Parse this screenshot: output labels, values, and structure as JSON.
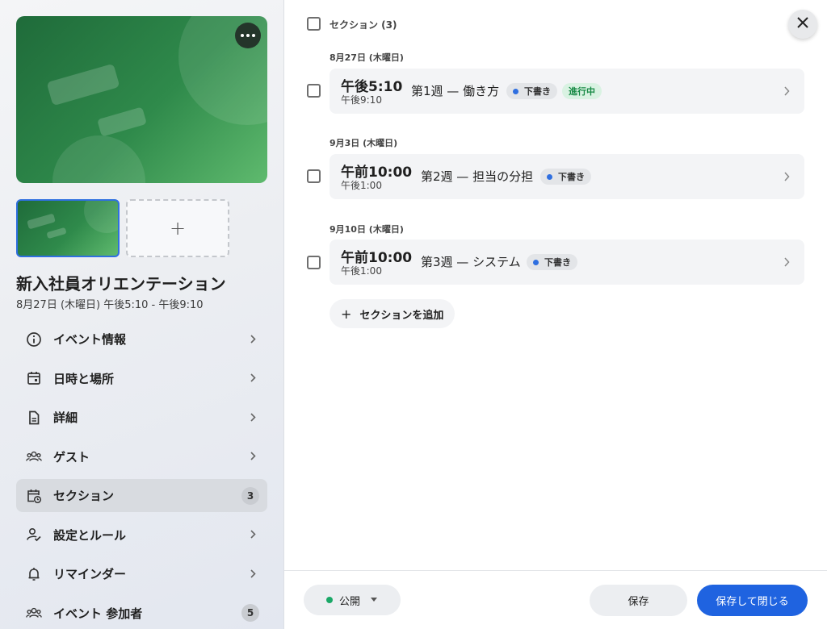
{
  "colors": {
    "accent": "#1f63e0",
    "active_nav": "#d8dbe0",
    "draft_dot": "#2f6fe0",
    "in_progress": "#188a45",
    "public_dot": "#1aa867"
  },
  "hero": {
    "more_icon": "more-horizontal-icon"
  },
  "media": {
    "add_symbol": "+"
  },
  "event": {
    "title": "新入社員オリエンテーション",
    "date": "8月27日 (木曜日) 午後5:10 - 午後9:10"
  },
  "sidebar": {
    "items": [
      {
        "label": "イベント情報",
        "icon": "info-icon"
      },
      {
        "label": "日時と場所",
        "icon": "calendar-icon"
      },
      {
        "label": "詳細",
        "icon": "document-icon"
      },
      {
        "label": "ゲスト",
        "icon": "group-icon"
      },
      {
        "label": "セクション",
        "icon": "calendar-clock-icon",
        "badge": "3",
        "active": true
      },
      {
        "label": "設定とルール",
        "icon": "person-check-icon"
      },
      {
        "label": "リマインダー",
        "icon": "bell-icon"
      },
      {
        "label": "イベント 参加者",
        "icon": "group-icon",
        "badge": "5"
      }
    ]
  },
  "main": {
    "header_label": "セクション (3)",
    "groups": [
      {
        "date": "8月27日 (木曜日)",
        "start": "午後5:10",
        "end": "午後9:10",
        "title": "第1週 — 働き方",
        "status": "下書き",
        "progress": "進行中"
      },
      {
        "date": "9月3日 (木曜日)",
        "start": "午前10:00",
        "end": "午後1:00",
        "title": "第2週 — 担当の分担",
        "status": "下書き"
      },
      {
        "date": "9月10日 (木曜日)",
        "start": "午前10:00",
        "end": "午後1:00",
        "title": "第3週 — システム",
        "status": "下書き"
      }
    ],
    "add_section_label": "セクションを追加"
  },
  "footer": {
    "visibility": "公開",
    "save": "保存",
    "save_close": "保存して閉じる"
  }
}
